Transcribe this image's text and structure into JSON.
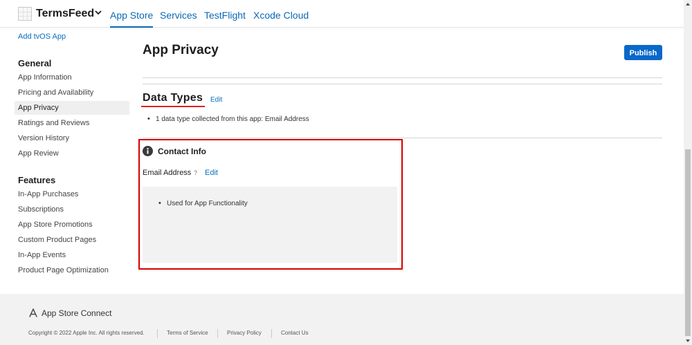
{
  "header": {
    "team_name": "TermsFeed",
    "tabs": [
      "App Store",
      "Services",
      "TestFlight",
      "Xcode Cloud"
    ]
  },
  "sidebar": {
    "top_link": "Add tvOS App",
    "general_heading": "General",
    "general_items": [
      "App Information",
      "Pricing and Availability",
      "App Privacy",
      "Ratings and Reviews",
      "Version History",
      "App Review"
    ],
    "features_heading": "Features",
    "features_items": [
      "In-App Purchases",
      "Subscriptions",
      "App Store Promotions",
      "Custom Product Pages",
      "In-App Events",
      "Product Page Optimization"
    ]
  },
  "main": {
    "title": "App Privacy",
    "publish_label": "Publish",
    "data_types_title": "Data Types",
    "edit_label": "Edit",
    "data_types_summary": "1 data type collected from this app: Email Address",
    "contact_info_title": "Contact Info",
    "email_label": "Email Address",
    "help_mark": "?",
    "usage_items": [
      "Used for App Functionality"
    ]
  },
  "footer": {
    "brand": "App Store Connect",
    "copyright": "Copyright © 2022 Apple Inc. All rights reserved.",
    "links": [
      "Terms of Service",
      "Privacy Policy",
      "Contact Us"
    ]
  },
  "colors": {
    "accent": "#0a68b7",
    "publish_button": "#0a68c9",
    "highlight_red": "#d20000"
  },
  "icons": [
    "team-logo-icon",
    "chevron-down-icon",
    "info-icon",
    "app-store-connect-icon"
  ]
}
